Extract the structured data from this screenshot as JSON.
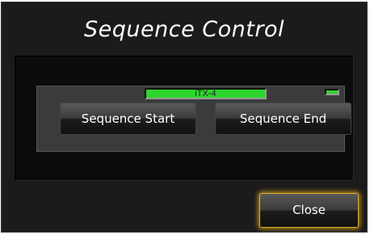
{
  "window": {
    "title": "Sequence Control"
  },
  "status": {
    "device_label": "iTX-4",
    "bar_color": "#2ed62e",
    "indicator_color": "#2ed62e"
  },
  "buttons": {
    "sequence_start": "Sequence Start",
    "sequence_end": "Sequence End",
    "close": "Close"
  },
  "colors": {
    "background": "#1b1b1b",
    "panel": "#3b3b3b",
    "close_glow": "#d8b02a"
  }
}
